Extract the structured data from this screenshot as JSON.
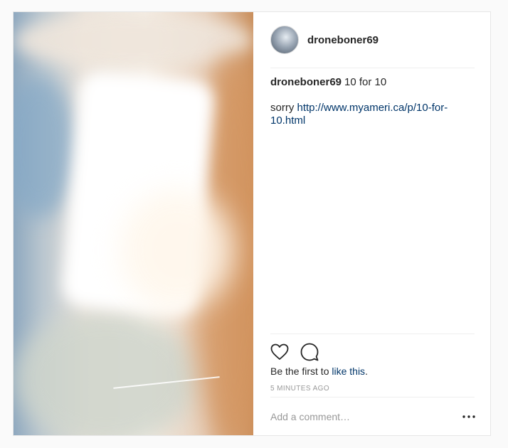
{
  "post": {
    "username": "droneboner69",
    "caption_user": "droneboner69",
    "caption_text": "10 for 10",
    "caption_line2_prefix": "sorry ",
    "caption_link": "http://www.myameri.ca/p/10-for-10.html",
    "likes_prefix": "Be the first to ",
    "likes_link": "like this",
    "likes_suffix": ".",
    "timestamp": "5 MINUTES AGO",
    "comment_placeholder": "Add a comment…"
  },
  "icons": {
    "avatar": "user-avatar",
    "like": "heart-icon",
    "comment": "comment-bubble-icon",
    "more": "more-options-icon"
  },
  "colors": {
    "link": "#003569",
    "text": "#262626",
    "muted": "#999999",
    "border": "#efefef",
    "background": "#fafafa"
  }
}
